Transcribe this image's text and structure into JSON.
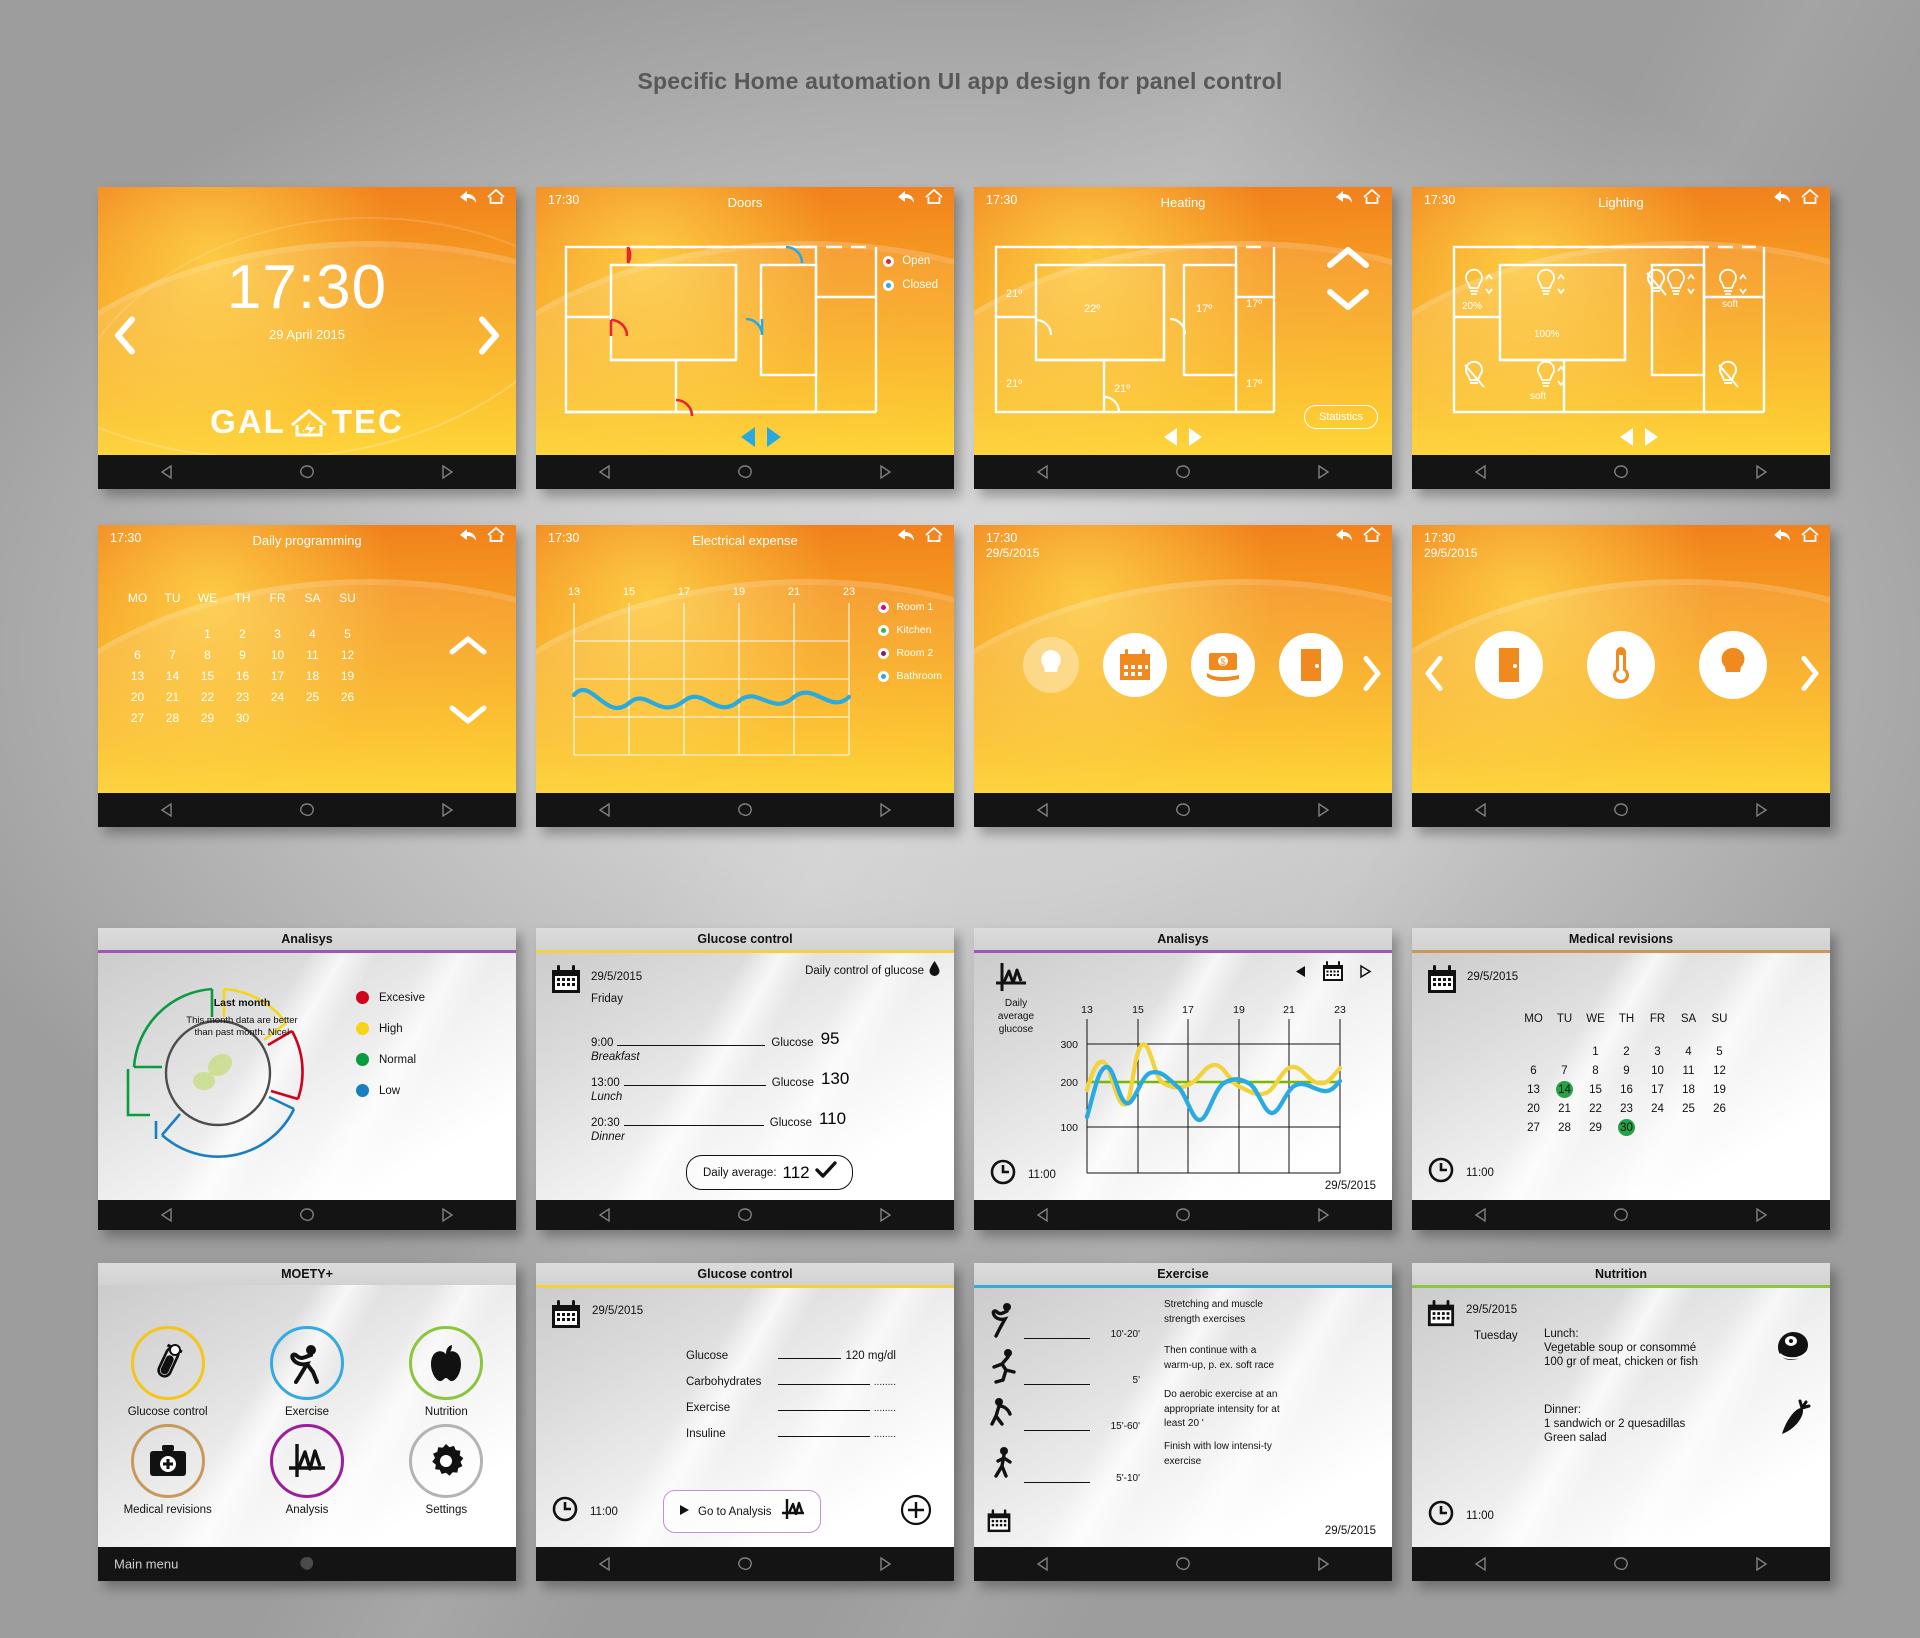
{
  "page": {
    "title": "Specific Home automation UI app design for panel control"
  },
  "common": {
    "nav": {
      "back": "back-triangle",
      "home": "home-blob",
      "recent": "forward-triangle"
    },
    "time": "17:30",
    "date_short": "29/5/2015",
    "clock_time": "11:00"
  },
  "screens": {
    "home": {
      "clock": "17:30",
      "date": "29 April 2015",
      "brand": "GAL TEC",
      "brand_left": "GAL",
      "brand_right": "TEC",
      "arrow_left": "‹",
      "arrow_right": "›"
    },
    "doors": {
      "time": "17:30",
      "title": "Doors",
      "legend": [
        {
          "label": "Open",
          "color": "#e8262d"
        },
        {
          "label": "Closed",
          "color": "#27a9e1"
        }
      ]
    },
    "heating": {
      "time": "17:30",
      "title": "Heating",
      "temps": [
        "21º",
        "22º",
        "17º",
        "17º",
        "21º",
        "21º",
        "17º"
      ],
      "statistics_button": "Statistics"
    },
    "lighting": {
      "time": "17:30",
      "title": "Lighting",
      "values": [
        "20%",
        "100%",
        "soft",
        "soft",
        "soft"
      ]
    },
    "daily_programming": {
      "time": "17:30",
      "title": "Daily programming",
      "weekdays": [
        "MO",
        "TU",
        "WE",
        "TH",
        "FR",
        "SA",
        "SU"
      ],
      "weeks": [
        [
          "",
          "",
          "1",
          "2",
          "3",
          "4",
          "5"
        ],
        [
          "6",
          "7",
          "8",
          "9",
          "10",
          "11",
          "12"
        ],
        [
          "13",
          "14",
          "15",
          "16",
          "17",
          "18",
          "19"
        ],
        [
          "20",
          "21",
          "22",
          "23",
          "24",
          "25",
          "26"
        ],
        [
          "27",
          "28",
          "29",
          "30",
          "",
          "",
          ""
        ]
      ]
    },
    "electrical_expense": {
      "time": "17:30",
      "title": "Electrical expense",
      "legend": [
        {
          "label": "Room 1",
          "color": "#e6007e"
        },
        {
          "label": "Kitchen",
          "color": "#39b54a"
        },
        {
          "label": "Room 2",
          "color": "#8b1a6b"
        },
        {
          "label": "Bathroom",
          "color": "#29abe2"
        }
      ]
    },
    "menu_a": {
      "time": "17:30",
      "date": "29/5/2015",
      "items": [
        "bulb-icon",
        "calendar-icon",
        "money-hand-icon",
        "door-icon"
      ],
      "arrow_right": "›"
    },
    "menu_b": {
      "time": "17:30",
      "date": "29/5/2015",
      "items": [
        "door-icon",
        "thermometer-icon",
        "bulb-icon"
      ],
      "arrow_left": "‹",
      "arrow_right": "›"
    },
    "analisys_donut": {
      "title": "Analisys",
      "accent": "#9b59b6",
      "center_heading": "Last month",
      "center_text": "This month data are better than past month. Nice!",
      "legend": [
        {
          "label": "Excesive",
          "color": "#d0021b"
        },
        {
          "label": "High",
          "color": "#f7d417"
        },
        {
          "label": "Normal",
          "color": "#0a9b3f"
        },
        {
          "label": "Low",
          "color": "#1a7fc1"
        }
      ]
    },
    "glucose_control_log": {
      "title": "Glucose control",
      "accent": "#f2d33c",
      "date": "29/5/2015",
      "weekday": "Friday",
      "subtitle": "Daily control of glucose",
      "entries": [
        {
          "time": "9:00",
          "meal": "Breakfast",
          "label": "Glucose",
          "value": "95"
        },
        {
          "time": "13:00",
          "meal": "Lunch",
          "label": "Glucose",
          "value": "130"
        },
        {
          "time": "20:30",
          "meal": "Dinner",
          "label": "Glucose",
          "value": "110"
        }
      ],
      "average_label": "Daily average:",
      "average_value": "112"
    },
    "analisys_chart": {
      "title": "Analisys",
      "accent": "#9b59b6",
      "icon_caption": "Daily average glucose",
      "clock": "11:00",
      "date": "29/5/2015"
    },
    "medical_revisions": {
      "title": "Medical revisions",
      "accent": "#c79a5c",
      "date": "29/5/2015",
      "clock": "11:00",
      "weekdays": [
        "MO",
        "TU",
        "WE",
        "TH",
        "FR",
        "SA",
        "SU"
      ],
      "weeks": [
        [
          "",
          "",
          "1",
          "2",
          "3",
          "4",
          "5"
        ],
        [
          "6",
          "7",
          "8",
          "9",
          "10",
          "11",
          "12"
        ],
        [
          "13",
          "14",
          "15",
          "16",
          "17",
          "18",
          "19"
        ],
        [
          "20",
          "21",
          "22",
          "23",
          "24",
          "25",
          "26"
        ],
        [
          "27",
          "28",
          "29",
          "30",
          "",
          "",
          ""
        ]
      ],
      "highlighted": [
        "14",
        "30"
      ],
      "highlight_color": "#25a244"
    },
    "moety_menu": {
      "title": "MOETY+",
      "footer": "Main menu",
      "items": [
        {
          "label": "Glucose control",
          "icon": "test-tube-icon",
          "ring": "#f5c518"
        },
        {
          "label": "Exercise",
          "icon": "stretching-person-icon",
          "ring": "#36a9e1"
        },
        {
          "label": "Nutrition",
          "icon": "apple-icon",
          "ring": "#8cc63e"
        },
        {
          "label": "Medical revisions",
          "icon": "first-aid-kit-icon",
          "ring": "#c79a5c"
        },
        {
          "label": "Analysis",
          "icon": "chart-icon",
          "ring": "#9b1f9b"
        },
        {
          "label": "Settings",
          "icon": "gear-icon",
          "ring": "#b3b3b3"
        }
      ]
    },
    "glucose_control_form": {
      "title": "Glucose control",
      "accent": "#f2d33c",
      "date": "29/5/2015",
      "clock": "11:00",
      "fields": [
        {
          "label": "Glucose",
          "value": "120 mg/dl"
        },
        {
          "label": "Carbohydrates",
          "value": "........"
        },
        {
          "label": "Exercise",
          "value": "........"
        },
        {
          "label": "Insuline",
          "value": "........"
        }
      ],
      "go_button": "Go to Analysis",
      "add_button": "+"
    },
    "exercise": {
      "title": "Exercise",
      "accent": "#36a9e1",
      "date": "29/5/2015",
      "rows": [
        {
          "icon": "stretching-person-icon",
          "duration": "10'-20'",
          "text": "Stretching and muscle strength exercises"
        },
        {
          "icon": "running-person-icon",
          "duration": "5'",
          "text": "Then continue with a warm-up, p. ex. soft race"
        },
        {
          "icon": "aerobic-person-icon",
          "duration": "15'-60'",
          "text": "Do aerobic exercise at an appropriate intensity for at least 20 '"
        },
        {
          "icon": "walking-person-icon",
          "duration": "5'-10'",
          "text": "Finish with low intensi-ty exercise"
        }
      ]
    },
    "nutrition": {
      "title": "Nutrition",
      "accent": "#8cc63e",
      "date": "29/5/2015",
      "weekday": "Tuesday",
      "clock": "11:00",
      "lunch_label": "Lunch:",
      "lunch_lines": [
        "Vegetable soup or consommé",
        "100 gr of meat, chicken or fish"
      ],
      "lunch_icon": "meat-icon",
      "dinner_label": "Dinner:",
      "dinner_lines": [
        "1 sandwich or 2 quesadillas",
        "Green salad"
      ],
      "dinner_icon": "carrot-icon"
    }
  },
  "chart_data": [
    {
      "type": "line",
      "name": "electrical_expense",
      "title": "Electrical expense",
      "xlabel": "",
      "ylabel": "",
      "x": [
        13,
        15,
        17,
        19,
        21,
        23
      ],
      "tick_labels": [
        "13",
        "15",
        "17",
        "19",
        "21",
        "23"
      ],
      "grid": true,
      "legend_position": "right",
      "series": [
        {
          "name": "Room 1",
          "color": "#e6007e",
          "values": [
            0,
            0,
            0,
            0,
            0,
            0
          ]
        },
        {
          "name": "Kitchen",
          "color": "#39b54a",
          "values": [
            0,
            0,
            0,
            0,
            0,
            0
          ]
        },
        {
          "name": "Room 2",
          "color": "#8b1a6b",
          "values": [
            0,
            0,
            0,
            0,
            0,
            0
          ]
        },
        {
          "name": "Bathroom",
          "color": "#29abe2",
          "values": [
            52,
            38,
            55,
            42,
            58,
            46
          ]
        }
      ]
    },
    {
      "type": "pie",
      "name": "analisys_donut",
      "title": "Analisys",
      "labels": [
        "Excesive",
        "High",
        "Normal",
        "Low"
      ],
      "colors": [
        "#d0021b",
        "#f7d417",
        "#0a9b3f",
        "#1a7fc1"
      ],
      "values": [
        20,
        17,
        28,
        35
      ],
      "annotation": "Last month — This month data are better than past month. Nice!"
    },
    {
      "type": "line",
      "name": "analisys_glucose",
      "title": "Analisys",
      "ylabel": "Daily average glucose",
      "x": [
        13,
        15,
        17,
        19,
        21,
        23
      ],
      "tick_labels": [
        "13",
        "15",
        "17",
        "19",
        "21",
        "23"
      ],
      "ytick_labels": [
        "100",
        "200",
        "300"
      ],
      "ylim": [
        0,
        400
      ],
      "grid": true,
      "series": [
        {
          "name": "yellow",
          "color": "#f2d33c",
          "values": [
            180,
            255,
            128,
            295,
            168,
            185,
            240,
            200,
            170,
            225,
            240,
            190,
            230
          ]
        },
        {
          "name": "blue",
          "color": "#29abe2",
          "values": [
            145,
            232,
            165,
            215,
            210,
            190,
            122,
            200,
            225,
            185,
            145,
            215,
            195
          ]
        },
        {
          "name": "green-baseline",
          "color": "#7ab800",
          "values": [
            183,
            183,
            183,
            183,
            183,
            183,
            183,
            183,
            183,
            183,
            183,
            183,
            183
          ]
        }
      ]
    }
  ]
}
